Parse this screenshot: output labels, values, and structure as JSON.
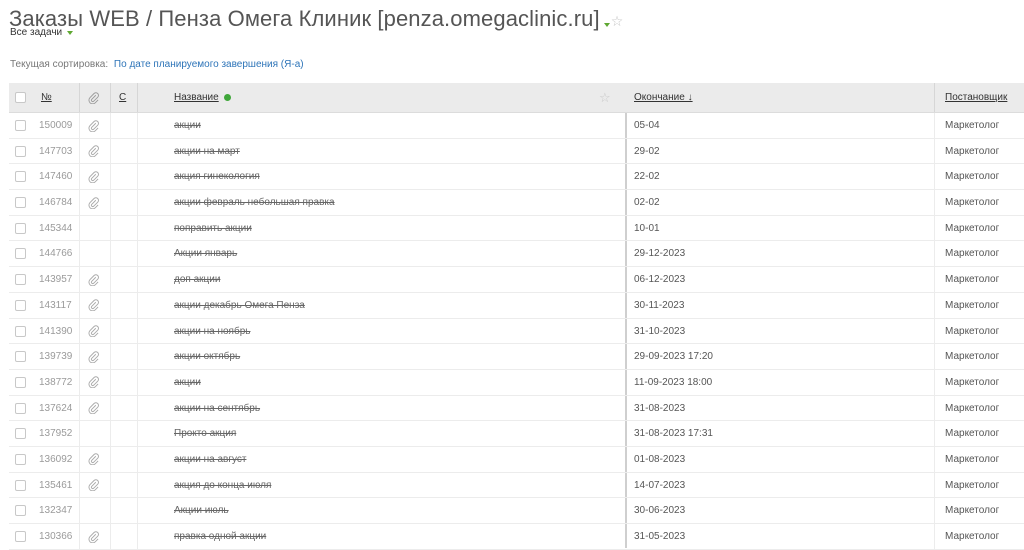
{
  "header": {
    "title": "Заказы WEB / Пенза Омега Клиник [penza.omegaclinic.ru]",
    "star_icon": "☆",
    "filter_label": "Все задачи",
    "sort_label": "Текущая сортировка:",
    "sort_value": "По дате планируемого завершения (Я-а)"
  },
  "columns": {
    "num": "№",
    "c": "С",
    "name": "Название",
    "end": "Окончание ↓",
    "author": "Постановщик"
  },
  "rows": [
    {
      "id": "150009",
      "attach": true,
      "name": "акции",
      "end": "05-04",
      "author": "Маркетолог"
    },
    {
      "id": "147703",
      "attach": true,
      "name": "акции на март",
      "end": "29-02",
      "author": "Маркетолог"
    },
    {
      "id": "147460",
      "attach": true,
      "name": "акция гинекология",
      "end": "22-02",
      "author": "Маркетолог"
    },
    {
      "id": "146784",
      "attach": true,
      "name": "акции февраль небольшая правка",
      "end": "02-02",
      "author": "Маркетолог"
    },
    {
      "id": "145344",
      "attach": false,
      "name": "поправить акции",
      "end": "10-01",
      "author": "Маркетолог"
    },
    {
      "id": "144766",
      "attach": false,
      "name": "Акции январь",
      "end": "29-12-2023",
      "author": "Маркетолог"
    },
    {
      "id": "143957",
      "attach": true,
      "name": "доп акции",
      "end": "06-12-2023",
      "author": "Маркетолог"
    },
    {
      "id": "143117",
      "attach": true,
      "name": "акции декабрь Омега Пенза",
      "end": "30-11-2023",
      "author": "Маркетолог"
    },
    {
      "id": "141390",
      "attach": true,
      "name": "акции на ноябрь",
      "end": "31-10-2023",
      "author": "Маркетолог"
    },
    {
      "id": "139739",
      "attach": true,
      "name": "акции октябрь",
      "end": "29-09-2023 17:20",
      "author": "Маркетолог"
    },
    {
      "id": "138772",
      "attach": true,
      "name": "акции",
      "end": "11-09-2023 18:00",
      "author": "Маркетолог"
    },
    {
      "id": "137624",
      "attach": true,
      "name": "акции на сентябрь",
      "end": "31-08-2023",
      "author": "Маркетолог"
    },
    {
      "id": "137952",
      "attach": false,
      "name": "Прокто акция",
      "end": "31-08-2023 17:31",
      "author": "Маркетолог"
    },
    {
      "id": "136092",
      "attach": true,
      "name": "акции на август",
      "end": "01-08-2023",
      "author": "Маркетолог"
    },
    {
      "id": "135461",
      "attach": true,
      "name": "акция до конца июля",
      "end": "14-07-2023",
      "author": "Маркетолог"
    },
    {
      "id": "132347",
      "attach": false,
      "name": "Акции июль",
      "end": "30-06-2023",
      "author": "Маркетолог"
    },
    {
      "id": "130366",
      "attach": true,
      "name": "правка одной акции",
      "end": "31-05-2023",
      "author": "Маркетолог"
    }
  ],
  "colors": {
    "accent_green": "#3fa73a",
    "link_blue": "#2d74b8",
    "header_bg": "#ebebeb"
  }
}
